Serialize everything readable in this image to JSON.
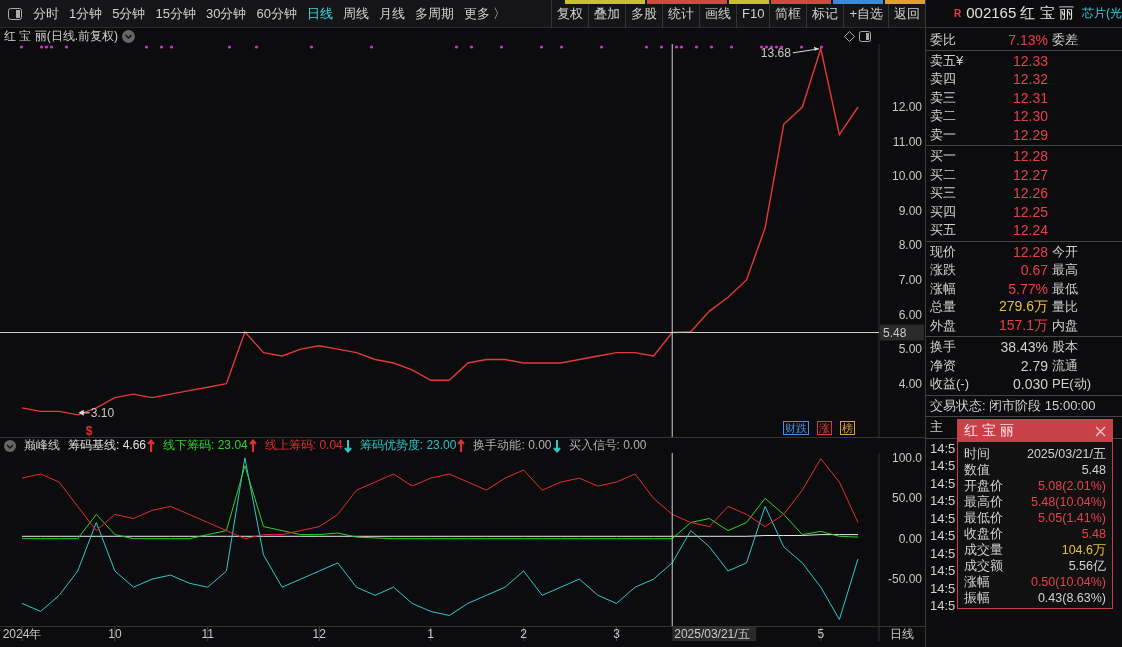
{
  "toolbar": {
    "periods": [
      {
        "label": "分时",
        "selected": false
      },
      {
        "label": "1分钟",
        "selected": false
      },
      {
        "label": "5分钟",
        "selected": false
      },
      {
        "label": "15分钟",
        "selected": false
      },
      {
        "label": "30分钟",
        "selected": false
      },
      {
        "label": "60分钟",
        "selected": false
      },
      {
        "label": "日线",
        "selected": true
      },
      {
        "label": "周线",
        "selected": false
      },
      {
        "label": "月线",
        "selected": false
      },
      {
        "label": "多周期",
        "selected": false
      },
      {
        "label": "更多 〉",
        "selected": false
      }
    ],
    "actions": [
      "复权",
      "叠加",
      "多股",
      "统计",
      "画线",
      "F10",
      "简框",
      "标记",
      "+自选",
      "返回"
    ]
  },
  "chart_title": "红 宝 丽(日线.前复权)",
  "price_chart": {
    "chart_data": {
      "type": "line",
      "ylim": [
        2.46,
        13.82
      ],
      "yticks": [
        {
          "value": 4,
          "label": "4.00"
        },
        {
          "value": 5,
          "label": "5.00"
        },
        {
          "value": 6,
          "label": "6.00"
        },
        {
          "value": 7,
          "label": "7.00"
        },
        {
          "value": 8,
          "label": "8.00"
        },
        {
          "value": 9,
          "label": "9.00"
        },
        {
          "value": 10,
          "label": "10.00"
        },
        {
          "value": 11,
          "label": "11.00"
        },
        {
          "value": 12,
          "label": "12.00"
        }
      ],
      "series": [
        {
          "color": "#e03a3a",
          "values": [
            3.3,
            3.2,
            3.2,
            3.1,
            3.3,
            3.6,
            3.7,
            3.6,
            3.7,
            3.8,
            3.9,
            4.0,
            5.5,
            4.9,
            4.8,
            5.0,
            5.1,
            5.0,
            4.9,
            4.7,
            4.6,
            4.4,
            4.1,
            4.1,
            4.6,
            4.7,
            4.7,
            4.6,
            4.6,
            4.6,
            4.7,
            4.8,
            4.9,
            4.9,
            4.8,
            5.48,
            5.5,
            6.1,
            6.5,
            7.0,
            8.5,
            11.5,
            12.0,
            13.68,
            11.2,
            12.0
          ]
        }
      ],
      "ref_lines": [
        {
          "axis": "y",
          "value": 5.48,
          "label": "5.48"
        }
      ],
      "annotations": [
        "13.68",
        "3.10"
      ]
    }
  },
  "signal_mark": "$",
  "badges": [
    {
      "label": "财跌",
      "color": "#4a8fe0"
    },
    {
      "label": "涨",
      "color": "#e03a3a"
    },
    {
      "label": "榜",
      "color": "#e0a040"
    }
  ],
  "indicator": {
    "name": "巅峰线",
    "legend": [
      {
        "label": "筹码基线: ",
        "value": "4.66",
        "color": "#e0e0e0",
        "arrow": {
          "kind": "up",
          "color": "#e03030"
        }
      },
      {
        "label": "线下筹码: ",
        "value": "23.04",
        "color": "#30d030",
        "arrow": {
          "kind": "up",
          "color": "#e03030"
        }
      },
      {
        "label": "线上筹码: ",
        "value": "0.04",
        "color": "#e03030",
        "arrow": {
          "kind": "down",
          "color": "#30c8c8"
        }
      },
      {
        "label": "筹码优势度: ",
        "value": "23.00",
        "color": "#30c0c0",
        "arrow": {
          "kind": "up",
          "color": "#e03030"
        }
      },
      {
        "label": "换手动能: ",
        "value": "0.00",
        "color": "#b0b0b0",
        "arrow": {
          "kind": "down",
          "color": "#30c8c8"
        }
      },
      {
        "label": "买入信号: ",
        "value": "0.00",
        "color": "#b0b0b0"
      }
    ],
    "chart_data": {
      "type": "line",
      "ylim": [
        -108,
        106
      ],
      "categories": [
        "2024年",
        null,
        null,
        null,
        null,
        "10",
        null,
        null,
        null,
        null,
        "11",
        null,
        null,
        null,
        null,
        null,
        "12",
        null,
        null,
        null,
        null,
        null,
        "1",
        null,
        null,
        null,
        null,
        "2",
        null,
        null,
        null,
        null,
        "3",
        null,
        null,
        null,
        null,
        null,
        null,
        null,
        null,
        null,
        null,
        "5",
        null,
        null
      ],
      "yticks": [
        {
          "value": 100,
          "label": "100.0"
        },
        {
          "value": 50,
          "label": "50.00"
        },
        {
          "value": 0,
          "label": "0.00"
        },
        {
          "value": -50,
          "label": "-50.00"
        }
      ],
      "series": [
        {
          "color": "#e03030",
          "values": [
            75,
            80,
            70,
            40,
            10,
            30,
            25,
            35,
            40,
            30,
            20,
            10,
            0,
            5,
            5,
            10,
            15,
            30,
            60,
            70,
            80,
            65,
            75,
            80,
            70,
            60,
            75,
            85,
            60,
            70,
            75,
            65,
            70,
            80,
            50,
            30,
            20,
            15,
            40,
            30,
            15,
            30,
            60,
            99,
            70,
            20
          ]
        },
        {
          "color": "#30d030",
          "values": [
            0,
            0,
            0,
            0,
            30,
            5,
            0,
            0,
            0,
            0,
            5,
            10,
            90,
            15,
            10,
            5,
            5,
            7,
            2,
            1,
            0,
            0,
            0,
            0,
            0,
            0,
            0,
            0,
            0,
            0,
            0,
            0,
            0,
            0,
            0,
            0,
            20,
            25,
            10,
            20,
            50,
            30,
            5,
            9,
            3,
            2
          ]
        },
        {
          "color": "#30c8c8",
          "values": [
            -80,
            -90,
            -70,
            -40,
            20,
            -40,
            -60,
            -50,
            -45,
            -55,
            -60,
            -40,
            100,
            -20,
            -60,
            -50,
            -40,
            -30,
            -60,
            -70,
            -60,
            -80,
            -90,
            -95,
            -80,
            -70,
            -60,
            -40,
            -70,
            -60,
            -50,
            -70,
            -80,
            -60,
            -50,
            -30,
            10,
            -10,
            -40,
            -30,
            40,
            -10,
            -30,
            -60,
            -100,
            -25
          ]
        },
        {
          "color": "#e8e8e8",
          "values": [
            3,
            3,
            3,
            3,
            3,
            3,
            3,
            3,
            3,
            3,
            3,
            3,
            3,
            3,
            3,
            3,
            3,
            3,
            3,
            3,
            3,
            3,
            3,
            3,
            3,
            3,
            3,
            3,
            3,
            3,
            3,
            3,
            3,
            3,
            3,
            3,
            3,
            3,
            3,
            3,
            4,
            4,
            4,
            5,
            5,
            5
          ]
        }
      ]
    },
    "crosshair_date": "2025/03/21/五"
  },
  "period_label": "日线",
  "quote": {
    "flag": "R",
    "code": "002165",
    "name": "红 宝 丽",
    "sector": "芯片(光",
    "commission": {
      "label": "委比",
      "value": "7.13%",
      "label2": "委差"
    },
    "sells": [
      {
        "label": "卖五¥",
        "price": "12.33"
      },
      {
        "label": "卖四",
        "price": "12.32"
      },
      {
        "label": "卖三",
        "price": "12.31"
      },
      {
        "label": "卖二",
        "price": "12.30"
      },
      {
        "label": "卖一",
        "price": "12.29"
      }
    ],
    "buys": [
      {
        "label": "买一",
        "price": "12.28"
      },
      {
        "label": "买二",
        "price": "12.27"
      },
      {
        "label": "买三",
        "price": "12.26"
      },
      {
        "label": "买四",
        "price": "12.25"
      },
      {
        "label": "买五",
        "price": "12.24"
      }
    ],
    "stats": [
      {
        "label": "现价",
        "value": "12.28",
        "color": "#e8404a",
        "label2": "今开"
      },
      {
        "label": "涨跌",
        "value": "0.67",
        "color": "#e8404a",
        "label2": "最高"
      },
      {
        "label": "涨幅",
        "value": "5.77%",
        "color": "#e8404a",
        "label2": "最低"
      },
      {
        "label": "总量",
        "value": "279.6万",
        "color": "#e8c040",
        "label2": "量比"
      },
      {
        "label": "外盘",
        "value": "157.1万",
        "color": "#e8404a",
        "label2": "内盘"
      }
    ],
    "stats2": [
      {
        "label": "换手",
        "value": "38.43%",
        "label2": "股本"
      },
      {
        "label": "净资",
        "value": "2.79",
        "label2": "流通"
      },
      {
        "label": "收益(-)",
        "value": "0.030",
        "label2": "PE(动)"
      }
    ],
    "trade_status": "交易状态: 闭市阶段 15:00:00",
    "main_force": "主",
    "ticks": [
      "14:5",
      "14:5",
      "14:5",
      "14:5",
      "14:5",
      "14:5",
      "14:5",
      "14:5",
      "14:5",
      "14:5"
    ]
  },
  "popup": {
    "title": "红 宝 丽",
    "rows": [
      {
        "label": "时间",
        "value": "2025/03/21/五",
        "color": "#d0d0d0"
      },
      {
        "label": "数值",
        "value": "5.48",
        "color": "#d0d0d0"
      },
      {
        "label": "开盘价",
        "value": "5.08(2.01%)",
        "color": "#e8404a"
      },
      {
        "label": "最高价",
        "value": "5.48(10.04%)",
        "color": "#e8404a"
      },
      {
        "label": "最低价",
        "value": "5.05(1.41%)",
        "color": "#e8404a"
      },
      {
        "label": "收盘价",
        "value": "5.48",
        "color": "#e8404a"
      },
      {
        "label": "成交量",
        "value": "104.6万",
        "color": "#e8c040"
      },
      {
        "label": "成交额",
        "value": "5.56亿",
        "color": "#d0d0d0"
      },
      {
        "label": "涨幅",
        "value": "0.50(10.04%)",
        "color": "#e8404a"
      },
      {
        "label": "振幅",
        "value": "0.43(8.63%)",
        "color": "#d0d0d0"
      }
    ]
  }
}
